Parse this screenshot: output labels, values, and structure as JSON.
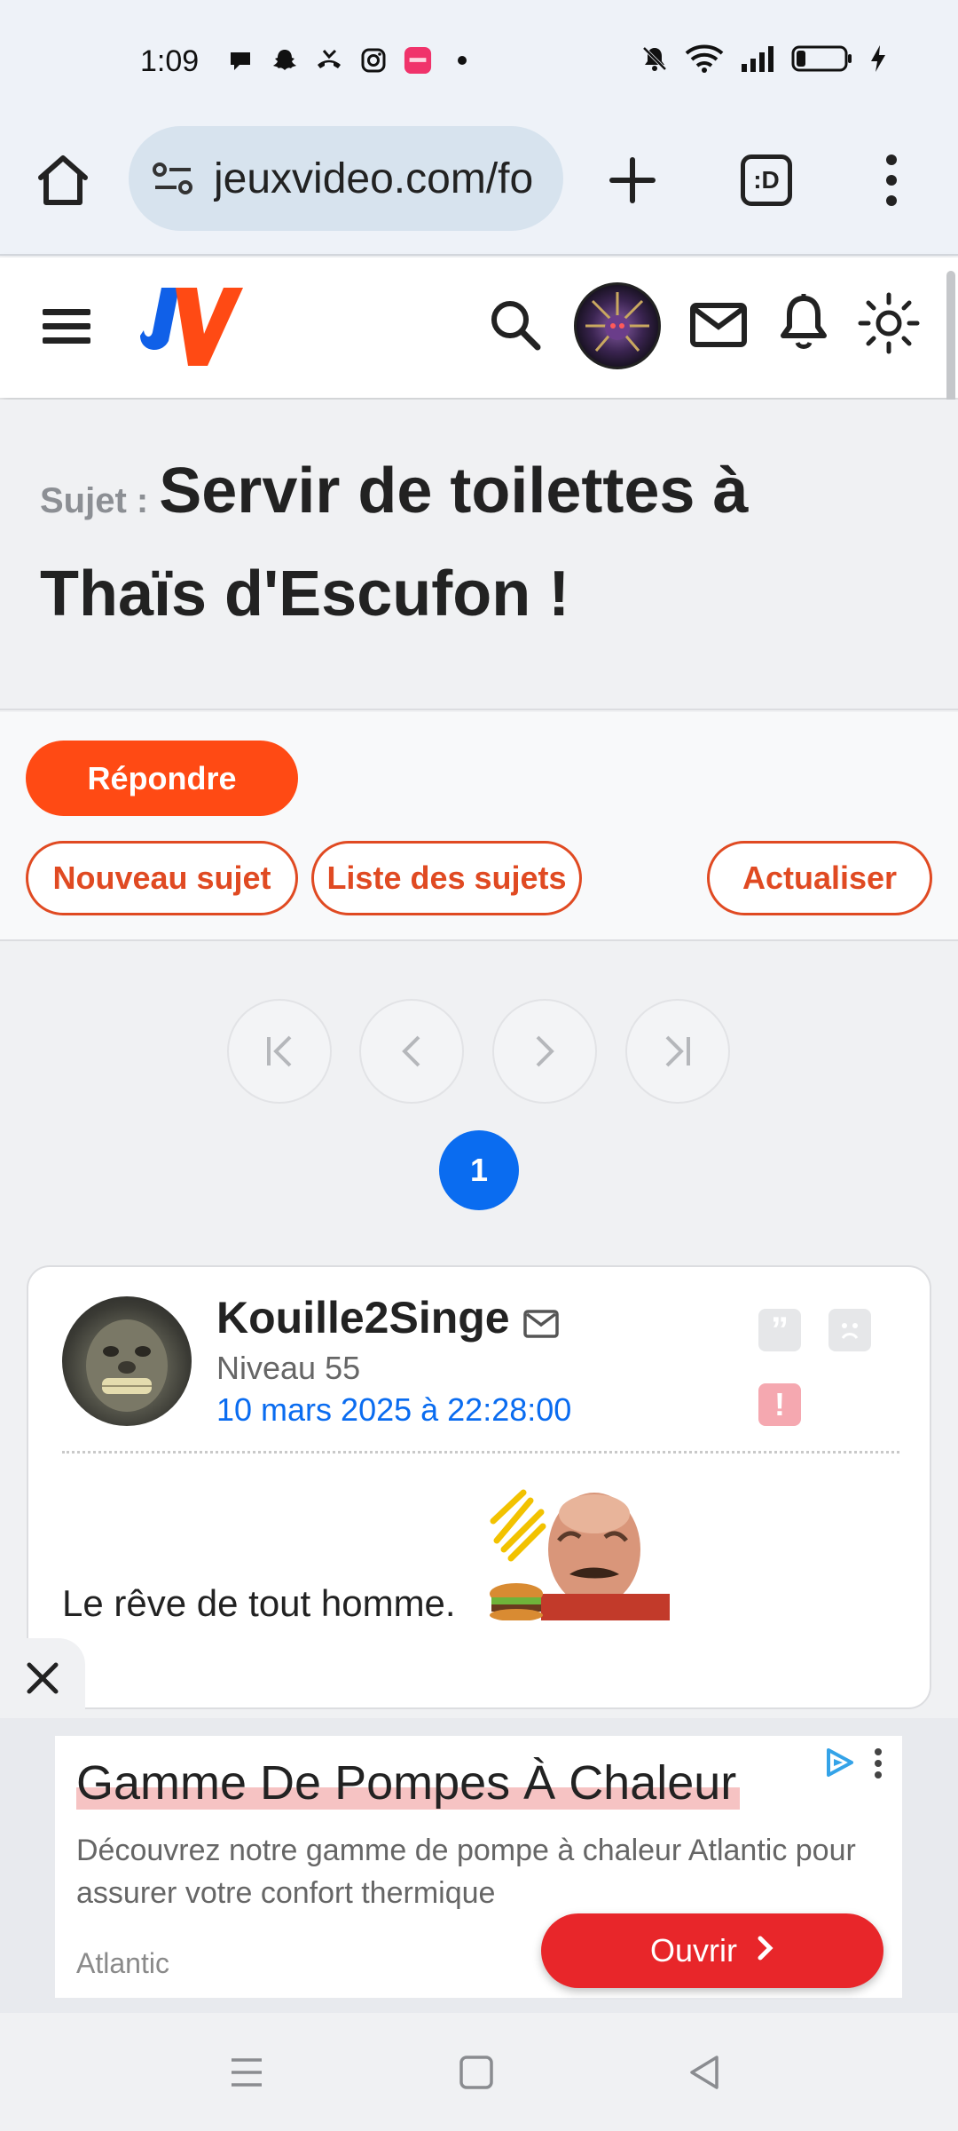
{
  "status_bar": {
    "time": "1:09",
    "left_icons": [
      "chat-bubble-icon",
      "snapchat-icon",
      "missed-call-icon",
      "instagram-icon",
      "app-badge-icon",
      "dot-icon"
    ],
    "right_icons": [
      "mute-icon",
      "wifi-icon",
      "signal-icon",
      "battery-icon",
      "charging-icon"
    ]
  },
  "browser": {
    "url": "jeuxvideo.com/fo",
    "tab_switcher_label": ":D"
  },
  "site_header": {
    "logo_text": "JV"
  },
  "topic": {
    "prefix": "Sujet :",
    "title": "Servir de toilettes à Thaïs d'Escufon !"
  },
  "actions": {
    "reply": "Répondre",
    "new_topic": "Nouveau sujet",
    "topic_list": "Liste des sujets",
    "refresh": "Actualiser"
  },
  "pagination": {
    "current_page": "1"
  },
  "post": {
    "author": "Kouille2Singe",
    "level": "Niveau 55",
    "date": "10 mars 2025 à 22:28:00",
    "content": "Le rêve de tout homme.",
    "quote_symbol": "”",
    "report_symbol": "!"
  },
  "ad": {
    "title": "Gamme De Pompes À Chaleur",
    "description": "Découvrez notre gamme de pompe à chaleur Atlantic pour assurer votre confort thermique",
    "brand": "Atlantic",
    "cta": "Ouvrir"
  },
  "colors": {
    "accent_orange": "#ff4a14",
    "link_blue": "#0a6cf0",
    "ad_button_red": "#e8262a"
  }
}
